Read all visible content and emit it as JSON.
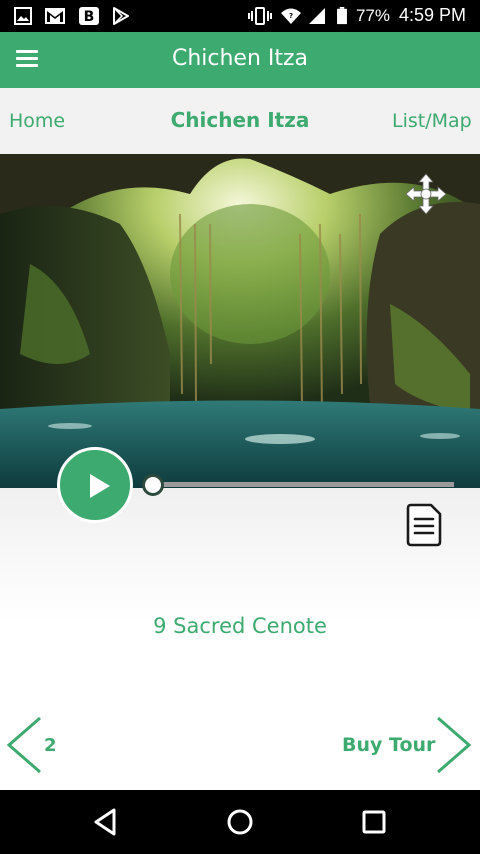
{
  "status_bar": {
    "battery_percent": "77%",
    "time": "4:59 PM",
    "notification_icons": [
      "image-icon",
      "gmail-icon",
      "b-icon",
      "play-store-icon"
    ],
    "system_icons": [
      "vibrate-icon",
      "wifi-icon",
      "signal-icon",
      "battery-icon"
    ]
  },
  "app_bar": {
    "title": "Chichen Itza",
    "menu_icon": "hamburger-menu-icon"
  },
  "sub_nav": {
    "home_label": "Home",
    "center_title": "Chichen Itza",
    "list_map_label": "List/Map"
  },
  "hero": {
    "image": "cenote-photo",
    "move_icon": "move-arrows-icon"
  },
  "player": {
    "play_icon": "play-icon",
    "progress": 0,
    "document_icon": "document-icon",
    "stop_name": "9 Sacred Cenote"
  },
  "bottom_nav": {
    "prev_number": "2",
    "next_label": "Buy Tour"
  },
  "system_nav": [
    "back-icon",
    "home-icon",
    "recents-icon"
  ],
  "colors": {
    "accent": "#3daa6f",
    "status_bar": "#000000",
    "sub_nav_bg": "#f2f2f2"
  }
}
